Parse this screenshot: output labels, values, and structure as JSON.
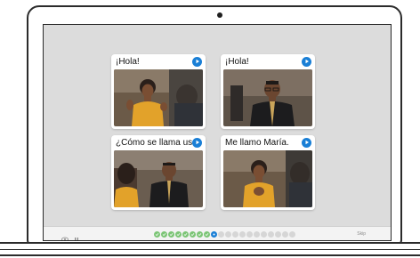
{
  "cards": [
    {
      "text": "¡Hola!"
    },
    {
      "text": "¡Hola!"
    },
    {
      "text": "¿Cómo se llama usted?"
    },
    {
      "text": "Me llamo María."
    }
  ],
  "footer": {
    "skip_label": "Skip",
    "progress": {
      "completed": 8,
      "current_index": 9,
      "total": 20
    }
  },
  "colors": {
    "accent": "#1a7fd6",
    "done": "#7cc576",
    "todo": "#d6d6d6"
  }
}
